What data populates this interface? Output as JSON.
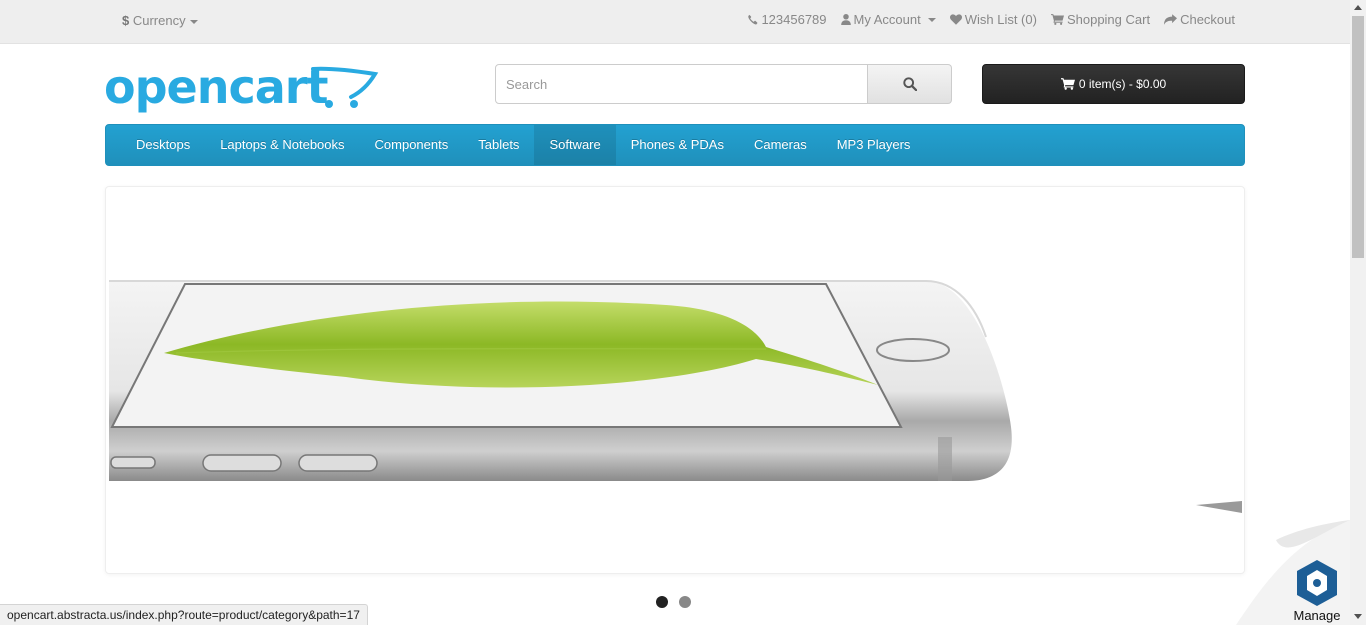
{
  "topbar": {
    "currency_symbol": "$",
    "currency_label": "Currency",
    "phone": "123456789",
    "my_account": "My Account",
    "wish_list": "Wish List (0)",
    "shopping_cart": "Shopping Cart",
    "checkout": "Checkout"
  },
  "header": {
    "logo_text": "opencart",
    "search_placeholder": "Search",
    "cart_button": "0 item(s) - $0.00"
  },
  "menu": {
    "items": [
      "Desktops",
      "Laptops & Notebooks",
      "Components",
      "Tablets",
      "Software",
      "Phones & PDAs",
      "Cameras",
      "MP3 Players"
    ],
    "active_index": 4
  },
  "slideshow": {
    "slide_count": 2,
    "active_slide": 1
  },
  "statusbar": {
    "url": "opencart.abstracta.us/index.php?route=product/category&path=17"
  },
  "widget": {
    "label": "Manage"
  },
  "colors": {
    "brand": "#29aae1",
    "menu": "#229ac8",
    "cart_button": "#2b2b2b"
  }
}
